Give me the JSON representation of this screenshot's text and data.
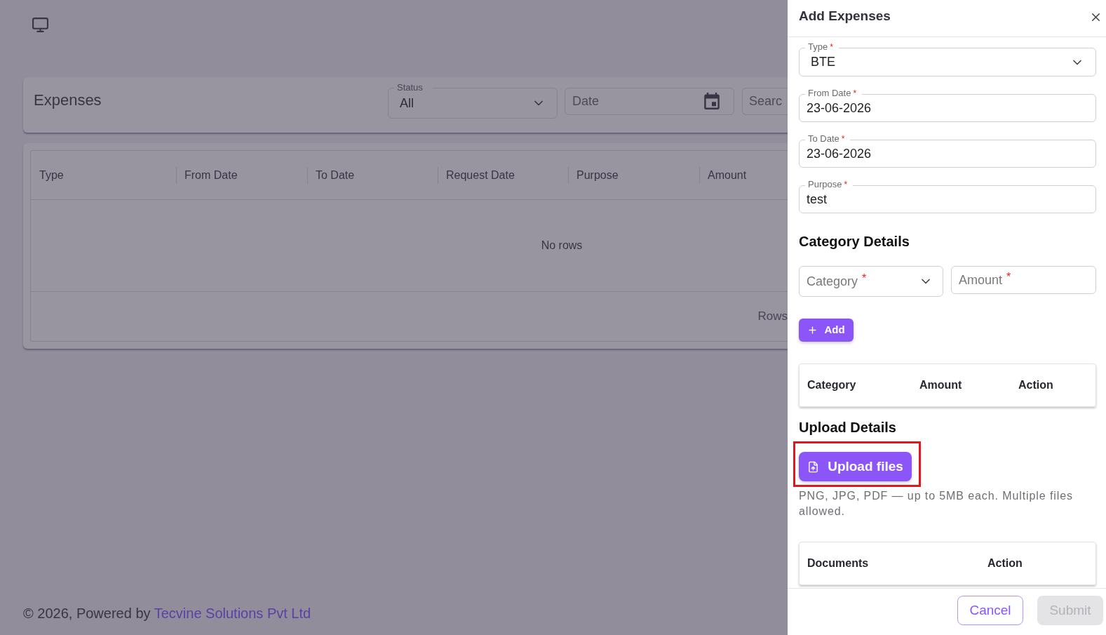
{
  "page": {
    "title": "Expenses",
    "filters": {
      "status": {
        "label": "Status",
        "value": "All"
      },
      "date": {
        "placeholder": "Date"
      },
      "search": {
        "placeholder": "Searc"
      }
    }
  },
  "table": {
    "columns": [
      "Type",
      "From Date",
      "To Date",
      "Request Date",
      "Purpose",
      "Amount"
    ],
    "empty_message": "No rows",
    "footer": "Rows"
  },
  "footer": {
    "text": "© 2026, Powered by",
    "link": "Tecvine Solutions Pvt Ltd"
  },
  "drawer": {
    "title": "Add Expenses",
    "fields": [
      {
        "kind": "select",
        "label": "Type",
        "required_mark": "*",
        "value": "BTE"
      },
      {
        "kind": "text",
        "label": "From Date",
        "required_mark": "*",
        "value": "23-06-2026"
      },
      {
        "kind": "text",
        "label": "To Date",
        "required_mark": "*",
        "value": "23-06-2026"
      },
      {
        "kind": "text",
        "label": "Purpose",
        "required_mark": "*",
        "value": "test"
      }
    ],
    "category_section": {
      "title": "Category Details",
      "inputs": [
        {
          "kind": "select",
          "label": "Category",
          "required_mark": "*"
        },
        {
          "kind": "text",
          "label": "Amount",
          "required_mark": "*"
        }
      ],
      "add_button": "Add",
      "table": {
        "columns": [
          "Category",
          "Amount",
          "Action"
        ]
      }
    },
    "upload_section": {
      "title": "Upload Details",
      "button": {
        "label": "Upload files",
        "highlighted": true
      },
      "hint": "PNG, JPG, PDF — up to 5MB each. Multiple files allowed.",
      "table": {
        "columns": [
          "Documents",
          "Action"
        ]
      }
    },
    "actions": [
      {
        "label": "Cancel",
        "kind": "outline",
        "disabled": false
      },
      {
        "label": "Submit",
        "kind": "filled",
        "disabled": true
      }
    ]
  }
}
